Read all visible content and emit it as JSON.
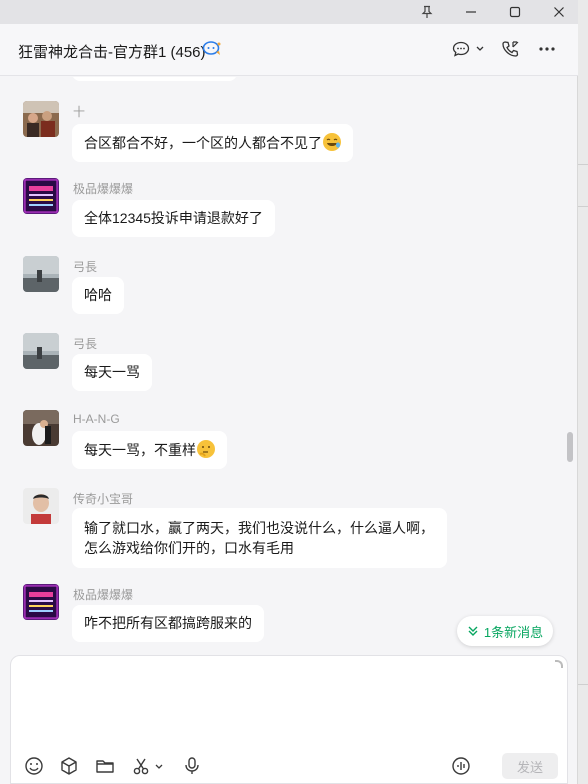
{
  "chat": {
    "title": "狂雷神龙合击-官方群1 (456)",
    "messages": [
      {
        "sender": "十",
        "text": "合区都合不好，一个区的人都合不见了"
      },
      {
        "sender": "极品爆爆爆",
        "text": "全体12345投诉申请退款好了"
      },
      {
        "sender": "弓長",
        "text": "哈哈"
      },
      {
        "sender": "弓長",
        "text": "每天一骂"
      },
      {
        "sender": "H-A-N-G",
        "text": "每天一骂，不重样"
      },
      {
        "sender": "传奇小宝哥",
        "text": "输了就口水，赢了两天，我们也没说什么，什么逼人啊，怎么游戏给你们开的，口水有毛用"
      },
      {
        "sender": "极品爆爆爆",
        "text": "咋不把所有区都搞跨服来的"
      }
    ],
    "avatar_badge_lines": [
      "鑫鑫商行",
      "200W... FEB",
      "永远鉴证本",
      "V: 947000XXX"
    ]
  },
  "new_messages_label": "1条新消息",
  "send_label": "发送",
  "icons": {
    "pin": "pin-icon",
    "minimize": "minimize-icon",
    "maximize": "maximize-icon",
    "close": "close-icon",
    "ai": "ai-chat-icon",
    "chat_menu": "chat-bubble-icon",
    "call": "phone-call-icon",
    "more": "more-icon",
    "emoji": "emoji-icon",
    "cube": "cube-icon",
    "folder": "folder-icon",
    "scissors": "scissors-icon",
    "mic": "microphone-icon",
    "voice": "voice-message-icon"
  },
  "colors": {
    "accent": "#07a660",
    "bubble": "#ffffff",
    "background": "#f5f5f7"
  }
}
